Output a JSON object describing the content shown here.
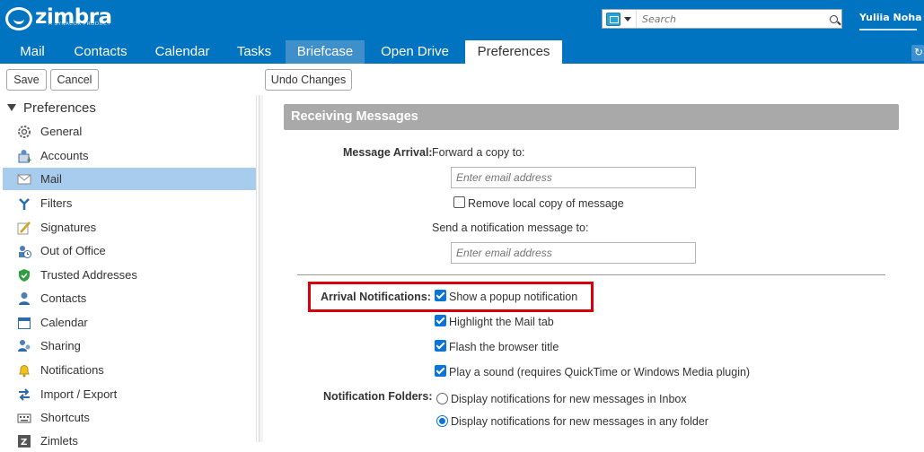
{
  "header": {
    "logo_text": "zimbra",
    "logo_sub": "A SYNACOR PRODUCT",
    "search_placeholder": "Search",
    "user_name": "Yuliia Noha",
    "colors": {
      "bar": "#0073c1",
      "tab_highlight": "#3f8fcb"
    }
  },
  "app_tabs": [
    {
      "label": "Mail"
    },
    {
      "label": "Contacts"
    },
    {
      "label": "Calendar"
    },
    {
      "label": "Tasks"
    },
    {
      "label": "Briefcase"
    },
    {
      "label": "Open Drive"
    },
    {
      "label": "Preferences"
    }
  ],
  "toolbar": {
    "save": "Save",
    "cancel": "Cancel",
    "undo": "Undo Changes"
  },
  "sidebar": {
    "title": "Preferences",
    "items": [
      {
        "label": "General",
        "icon": "gear-icon"
      },
      {
        "label": "Accounts",
        "icon": "accounts-icon"
      },
      {
        "label": "Mail",
        "icon": "envelope-icon"
      },
      {
        "label": "Filters",
        "icon": "filter-icon"
      },
      {
        "label": "Signatures",
        "icon": "signature-icon"
      },
      {
        "label": "Out of Office",
        "icon": "out-of-office-icon"
      },
      {
        "label": "Trusted Addresses",
        "icon": "shield-icon"
      },
      {
        "label": "Contacts",
        "icon": "contact-icon"
      },
      {
        "label": "Calendar",
        "icon": "calendar-icon"
      },
      {
        "label": "Sharing",
        "icon": "sharing-icon"
      },
      {
        "label": "Notifications",
        "icon": "bell-icon"
      },
      {
        "label": "Import / Export",
        "icon": "import-export-icon"
      },
      {
        "label": "Shortcuts",
        "icon": "keyboard-icon"
      },
      {
        "label": "Zimlets",
        "icon": "zimlet-icon"
      }
    ],
    "selected": "Mail"
  },
  "content": {
    "section_title": "Receiving Messages",
    "message_arrival_label": "Message Arrival:",
    "forward_copy_label": "Forward a copy to:",
    "forward_placeholder": "Enter email address",
    "remove_local_copy": "Remove local copy of message",
    "send_notification_label": "Send a notification message to:",
    "notification_placeholder": "Enter email address",
    "arrival_notifications_label": "Arrival Notifications:",
    "popup_notification": "Show a popup notification",
    "highlight_mail_tab": "Highlight the Mail tab",
    "flash_browser_title": "Flash the browser title",
    "play_sound": "Play a sound (requires QuickTime or Windows Media plugin)",
    "notification_folders_label": "Notification Folders:",
    "folders_inbox": "Display notifications for new messages in Inbox",
    "folders_any": "Display notifications for new messages in any folder",
    "checks": {
      "remove_local_copy": false,
      "popup": true,
      "highlight_tab": true,
      "flash_title": true,
      "play_sound": true
    },
    "folders_selected": "any"
  }
}
